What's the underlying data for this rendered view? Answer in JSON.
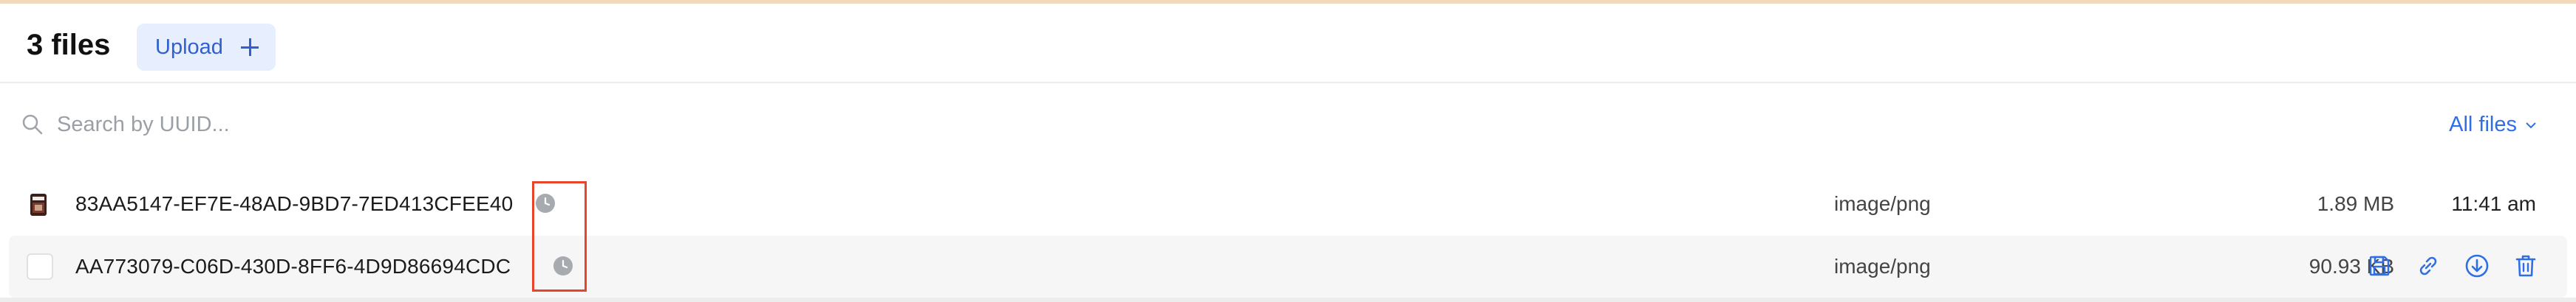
{
  "header": {
    "title": "3 files",
    "upload_label": "Upload"
  },
  "search": {
    "placeholder": "Search by UUID...",
    "value": "",
    "filter_label": "All files"
  },
  "files": [
    {
      "uuid": "83AA5147-EF7E-48AD-9BD7-7ED413CFEE40",
      "type": "image/png",
      "size": "1.89 MB",
      "time": "11:41 am",
      "status_icon": "clock-icon",
      "thumbnail": "image-thumbnail"
    },
    {
      "uuid": "AA773079-C06D-430D-8FF6-4D9D86694CDC",
      "type": "image/png",
      "size": "90.93 KB",
      "status_icon": "clock-icon",
      "actions": [
        "save-icon",
        "link-icon",
        "download-icon",
        "trash-icon"
      ]
    }
  ],
  "colors": {
    "accent": "#2f6fe6",
    "upload_bg": "#e7efff",
    "highlight": "#e8432b",
    "top_accent": "#f0d9bd"
  }
}
